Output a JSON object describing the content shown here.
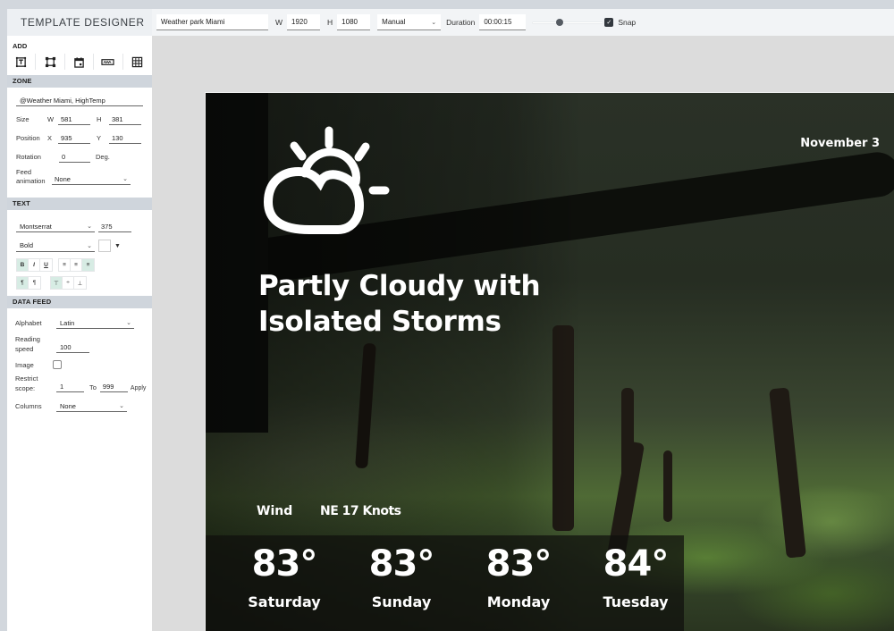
{
  "app": {
    "title": "TEMPLATE DESIGNER"
  },
  "toolbar": {
    "template_name": "Weather park Miami",
    "width_label": "W",
    "width_value": "1920",
    "height_label": "H",
    "height_value": "1080",
    "mode_select": "Manual",
    "duration_label": "Duration",
    "duration_value": "00:00:15",
    "snap_label": "Snap",
    "snap_checked": true
  },
  "sidebar": {
    "add": {
      "label": "ADD",
      "tools": [
        {
          "icon": "text-box-icon",
          "name": "add-text"
        },
        {
          "icon": "shape-icon",
          "name": "add-shape"
        },
        {
          "icon": "calendar-icon",
          "name": "add-date"
        },
        {
          "icon": "ticker-icon",
          "name": "add-ticker"
        },
        {
          "icon": "table-icon",
          "name": "add-table"
        }
      ]
    },
    "zone": {
      "label": "ZONE",
      "source": "@Weather Miami, HighTemp",
      "size_label": "Size",
      "w_label": "W",
      "w": "581",
      "h_label": "H",
      "h": "381",
      "position_label": "Position",
      "x_label": "X",
      "x": "935",
      "y_label": "Y",
      "y": "130",
      "rotation_label": "Rotation",
      "rotation": "0",
      "rotation_unit": "Deg.",
      "feed_animation_label_1": "Feed",
      "feed_animation_label_2": "animation",
      "feed_animation": "None"
    },
    "text": {
      "label": "TEXT",
      "font": "Montserrat",
      "size": "375",
      "weight": "Bold",
      "color": "#ffffff",
      "bold_on": true,
      "align_right_on": true,
      "ltr_on": true,
      "valign_top_on": true
    },
    "data_feed": {
      "label": "DATA FEED",
      "alphabet_label": "Alphabet",
      "alphabet": "Latin",
      "reading_speed_label_1": "Reading",
      "reading_speed_label_2": "speed",
      "reading_speed": "100",
      "image_label": "Image",
      "image_checked": false,
      "restrict_label_1": "Restrict",
      "restrict_label_2": "scope:",
      "restrict_from": "1",
      "restrict_to_label": "To",
      "restrict_to": "999",
      "apply_label": "Apply",
      "columns_label": "Columns",
      "columns": "None"
    }
  },
  "canvas": {
    "weather_icon": "partly-cloudy-icon",
    "condition_line1": "Partly Cloudy with",
    "condition_line2": "Isolated Storms",
    "date": "November 3",
    "wind_label": "Wind",
    "wind_value": "NE 17 Knots",
    "forecast": [
      {
        "temp": "83°",
        "day": "Saturday"
      },
      {
        "temp": "83°",
        "day": "Sunday"
      },
      {
        "temp": "83°",
        "day": "Monday"
      },
      {
        "temp": "84°",
        "day": "Tuesday"
      }
    ]
  },
  "colors": {
    "accent_toggle": "#d7ece4",
    "section_header": "#cfd5dc",
    "workspace": "#dcdcdc"
  }
}
